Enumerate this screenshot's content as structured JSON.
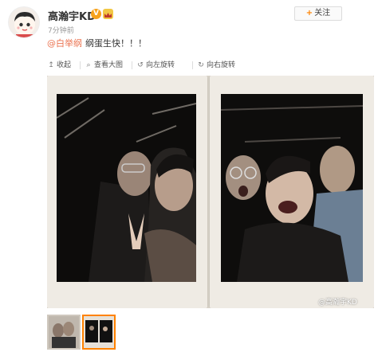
{
  "post": {
    "username": "高瀚宇KD",
    "verified_badge": "V",
    "timestamp": "7分钟前",
    "follow_label": "关注",
    "mention": "@白举纲",
    "text": "纲蛋生快！！！"
  },
  "toolbar": {
    "collapse": "收起",
    "view_large": "查看大图",
    "rotate_left": "向左旋转",
    "rotate_right": "向右旋转"
  },
  "image": {
    "watermark": "@高瀚宇KD"
  },
  "thumbnails": {
    "selected_index": 1
  },
  "colors": {
    "mention": "#eb7350",
    "follow_plus": "#ff8200",
    "thumb_selected": "#ff8200",
    "verified": "#f7a21b"
  },
  "icons": [
    "avatar-illustration",
    "verified-badge-icon",
    "vip-crown-icon",
    "collapse-icon",
    "zoom-icon",
    "rotate-left-icon",
    "rotate-right-icon"
  ]
}
